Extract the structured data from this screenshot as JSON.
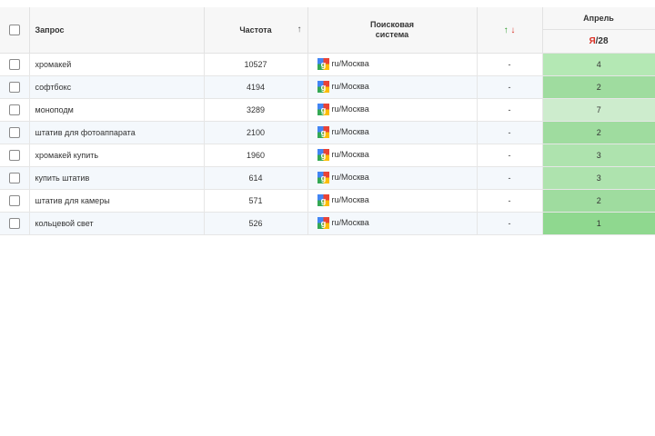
{
  "header": {
    "query": "Запрос",
    "frequency": "Частота",
    "sort_arrow": "↑",
    "search_engine_line1": "Поисковая",
    "search_engine_line2": "система",
    "trend_up": "↑",
    "trend_down": "↓",
    "month": "Апрель",
    "engine_letter": "Я",
    "engine_slash": "/",
    "engine_day": "28"
  },
  "rows": [
    {
      "query": "хромакей",
      "freq": "10527",
      "se": "ru/Москва",
      "trend": "-",
      "pos": "4",
      "pos_color": "#b4e8b4"
    },
    {
      "query": "софтбокс",
      "freq": "4194",
      "se": "ru/Москва",
      "trend": "-",
      "pos": "2",
      "pos_color": "#9fdc9f"
    },
    {
      "query": "моноподм",
      "freq": "3289",
      "se": "ru/Москва",
      "trend": "-",
      "pos": "7",
      "pos_color": "#cdeccd"
    },
    {
      "query": "штатив для фотоаппарата",
      "freq": "2100",
      "se": "ru/Москва",
      "trend": "-",
      "pos": "2",
      "pos_color": "#9fdc9f"
    },
    {
      "query": "хромакей купить",
      "freq": "1960",
      "se": "ru/Москва",
      "trend": "-",
      "pos": "3",
      "pos_color": "#aee3ae"
    },
    {
      "query": "купить штатив",
      "freq": "614",
      "se": "ru/Москва",
      "trend": "-",
      "pos": "3",
      "pos_color": "#aee3ae"
    },
    {
      "query": "штатив для камеры",
      "freq": "571",
      "se": "ru/Москва",
      "trend": "-",
      "pos": "2",
      "pos_color": "#9fdc9f"
    },
    {
      "query": "кольцевой свет",
      "freq": "526",
      "se": "ru/Москва",
      "trend": "-",
      "pos": "1",
      "pos_color": "#8fd88f"
    }
  ]
}
